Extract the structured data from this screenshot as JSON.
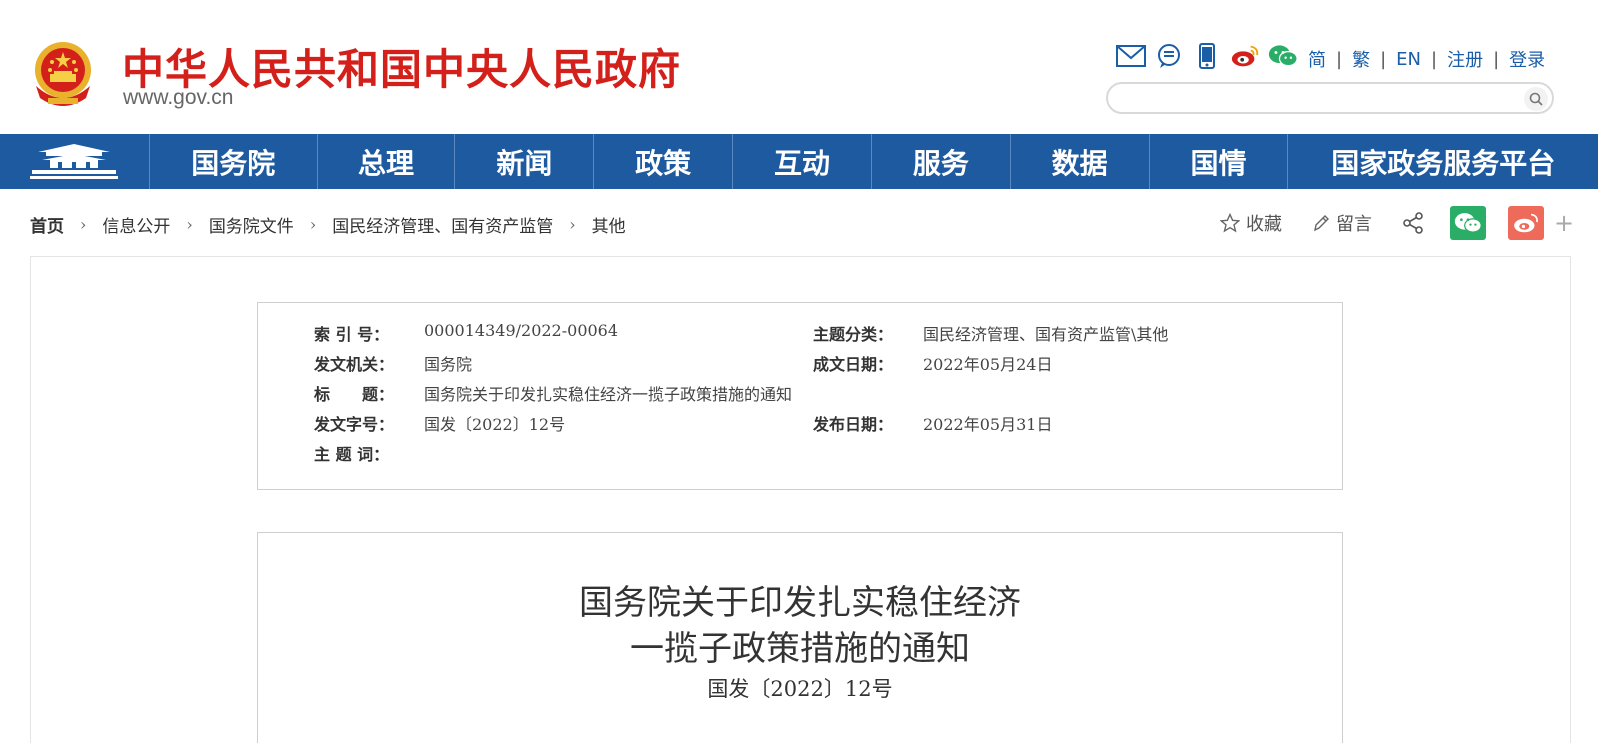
{
  "header": {
    "site_title": "中华人民共和国中央人民政府",
    "site_url": "www.gov.cn",
    "icons": [
      "mail-icon",
      "chat-icon",
      "mobile-icon",
      "weibo-icon",
      "wechat-icon"
    ],
    "lang_links": [
      "简",
      "繁",
      "EN",
      "注册",
      "登录"
    ],
    "search_placeholder": ""
  },
  "nav": {
    "items": [
      "国务院",
      "总理",
      "新闻",
      "政策",
      "互动",
      "服务",
      "数据",
      "国情",
      "国家政务服务平台"
    ]
  },
  "breadcrumb": [
    "首页",
    "信息公开",
    "国务院文件",
    "国民经济管理、国有资产监管",
    "其他"
  ],
  "tools": {
    "favorite": "收藏",
    "comment": "留言",
    "plus": "+"
  },
  "meta": {
    "index_label": "索 引 号：",
    "index_value": "000014349/2022-00064",
    "topic_label": "主题分类：",
    "topic_value": "国民经济管理、国有资产监管\\其他",
    "issuer_label": "发文机关：",
    "issuer_value": "国务院",
    "written_date_label": "成文日期：",
    "written_date_value": "2022年05月24日",
    "title_label": "标　　题：",
    "title_value": "国务院关于印发扎实稳住经济一揽子政策措施的通知",
    "doc_no_label": "发文字号：",
    "doc_no_value": "国发〔2022〕12号",
    "publish_date_label": "发布日期：",
    "publish_date_value": "2022年05月31日",
    "keywords_label": "主 题 词：",
    "keywords_value": ""
  },
  "document": {
    "title_line1": "国务院关于印发扎实稳住经济",
    "title_line2": "一揽子政策措施的通知",
    "number": "国发〔2022〕12号"
  },
  "colors": {
    "brand_red": "#d4201a",
    "nav_blue": "#1e5aa0",
    "link_blue": "#1a5ea8",
    "wechat_green": "#2aae67",
    "weibo_red": "#ee6a5a"
  }
}
